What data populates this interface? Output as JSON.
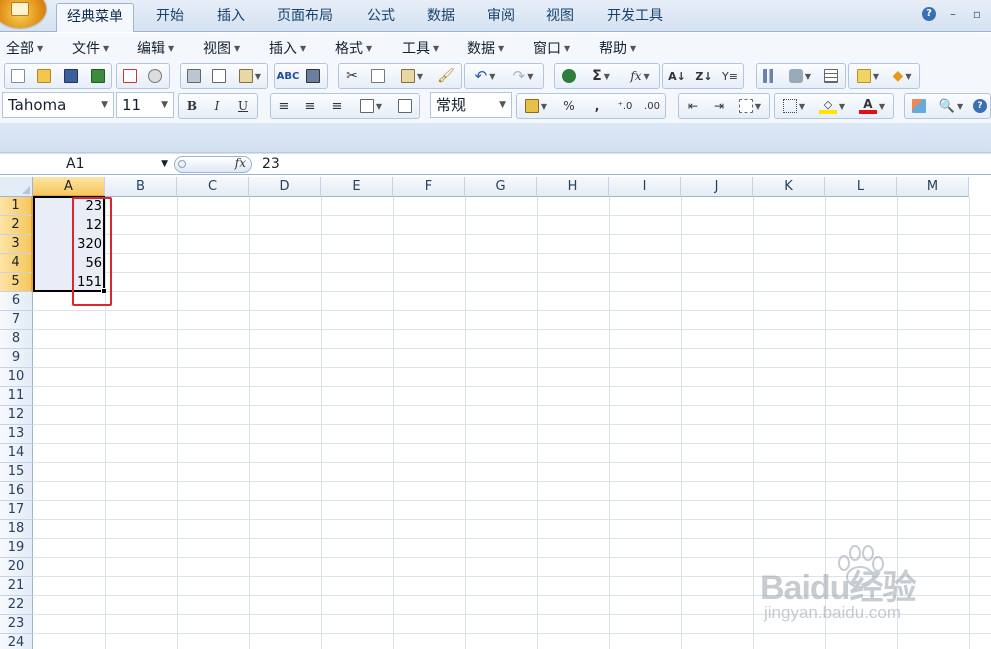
{
  "ribbon": {
    "tabs": [
      {
        "label": "经典菜单",
        "active": true
      },
      {
        "label": "开始"
      },
      {
        "label": "插入"
      },
      {
        "label": "页面布局"
      },
      {
        "label": "公式"
      },
      {
        "label": "数据"
      },
      {
        "label": "审阅"
      },
      {
        "label": "视图"
      },
      {
        "label": "开发工具"
      }
    ],
    "help": "?",
    "minimize": "–",
    "restore": "▫"
  },
  "menu": {
    "items": [
      "全部",
      "文件",
      "编辑",
      "视图",
      "插入",
      "格式",
      "工具",
      "数据",
      "窗口",
      "帮助"
    ]
  },
  "format_toolbar": {
    "font_name": "Tahoma",
    "font_size": "11",
    "bold": "B",
    "italic": "I",
    "underline": "U",
    "number_format": "常规",
    "percent": "%",
    "comma": ",",
    "inc_decimal": "⁺.0",
    "dec_decimal": ".00"
  },
  "standard_toolbar": {
    "sum": "Σ",
    "fx": "fx"
  },
  "formula_bar": {
    "name_box": "A1",
    "fx_label": "fx",
    "value": "23"
  },
  "sheet": {
    "columns": [
      "A",
      "B",
      "C",
      "D",
      "E",
      "F",
      "G",
      "H",
      "I",
      "J",
      "K",
      "L",
      "M"
    ],
    "rows": [
      "1",
      "2",
      "3",
      "4",
      "5",
      "6",
      "7",
      "8",
      "9",
      "10",
      "11",
      "12",
      "13",
      "14",
      "15",
      "16",
      "17",
      "18",
      "19",
      "20",
      "21",
      "22",
      "23",
      "24"
    ],
    "cells_A": [
      "23",
      "12",
      "320",
      "56",
      "151"
    ]
  },
  "watermark": {
    "brand": "Baidu经验",
    "url": "jingyan.baidu.com"
  }
}
